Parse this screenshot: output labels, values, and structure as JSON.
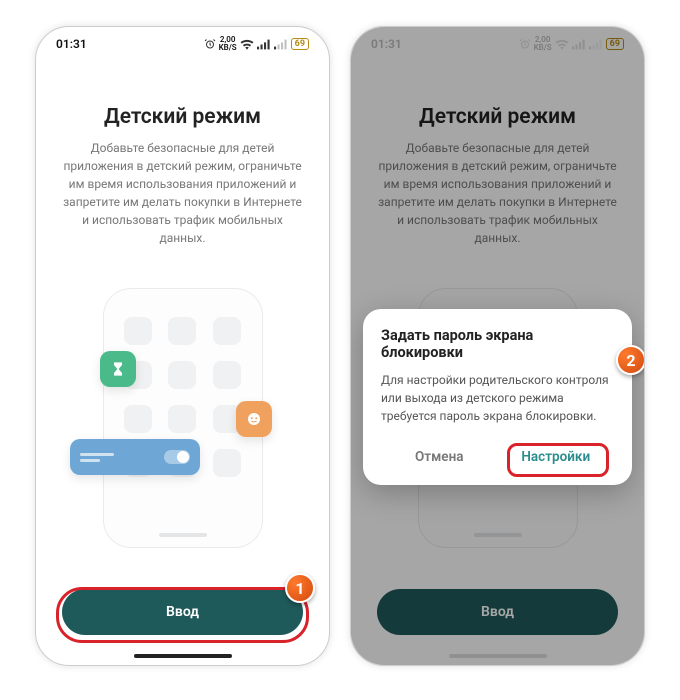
{
  "status": {
    "time": "01:31",
    "speed_top": "2,00",
    "speed_bottom": "KB/S",
    "battery": "69"
  },
  "page": {
    "title": "Детский режим",
    "description": "Добавьте безопасные для детей приложения в детский режим, ограничьте им время использования приложений и запретите им делать покупки в Интернете и использовать трафик мобильных данных.",
    "enter_button": "Ввод"
  },
  "dialog": {
    "title": "Задать пароль экрана блокировки",
    "body": "Для настройки родительского контроля или выхода из детского режима требуется пароль экрана блокировки.",
    "cancel": "Отмена",
    "settings": "Настройки"
  },
  "annotations": {
    "step1": "1",
    "step2": "2"
  }
}
